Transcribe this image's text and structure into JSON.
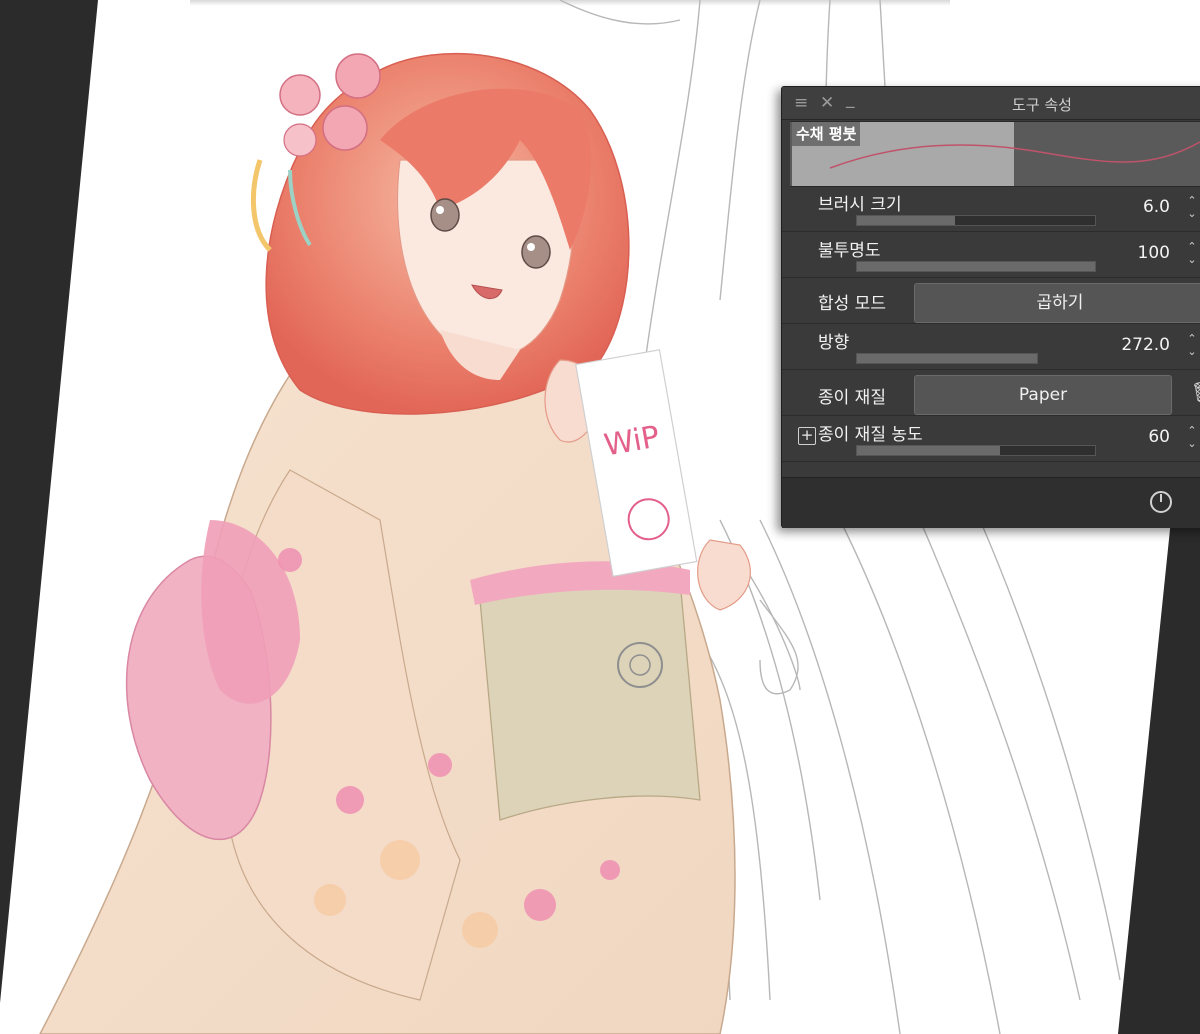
{
  "panel": {
    "title": "도구 속성",
    "menu_icon": "≡",
    "close_icon": "✕",
    "minimize_icon": "_",
    "preset_name": "수채 평붓",
    "rows": {
      "brush_size": {
        "label": "브러시 크기",
        "value": "6.0",
        "fill": 0.41
      },
      "opacity": {
        "label": "불투명도",
        "value": "100",
        "fill": 1.0
      },
      "blend_mode": {
        "label": "합성 모드",
        "value": "곱하기"
      },
      "direction": {
        "label": "방향",
        "value": "272.0",
        "fill": 0.76
      },
      "paper_texture": {
        "label": "종이 재질",
        "value": "Paper"
      },
      "paper_texture_density": {
        "label": "종이 재질 농도",
        "value": "60",
        "fill": 0.6
      }
    },
    "spinner_glyph": "⌃\n⌄",
    "colors": {
      "panel_bg": "#3a3a3a",
      "preset_highlight": "#a9a9a9",
      "stroke_accent": "#c0536b"
    }
  },
  "canvas": {
    "sign_text": "WiP",
    "icons": [
      "trash-icon",
      "reset-icon",
      "plus-icon",
      "menu-icon",
      "close-icon",
      "minimize-icon"
    ]
  }
}
